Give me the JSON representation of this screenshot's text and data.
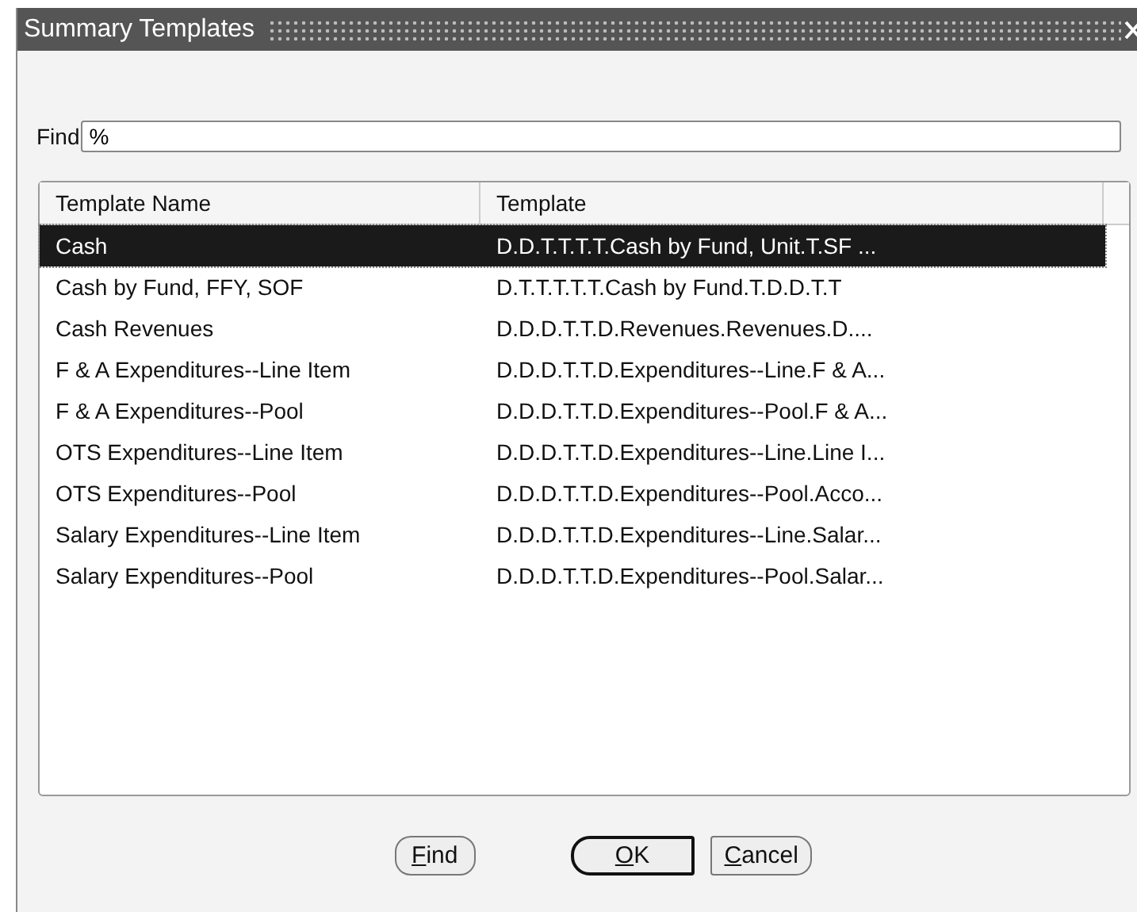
{
  "window": {
    "title": "Summary Templates"
  },
  "find": {
    "label": "Find",
    "value": "%"
  },
  "table": {
    "columns": [
      "Template Name",
      "Template"
    ],
    "rows": [
      {
        "name": "Cash",
        "template": "D.D.T.T.T.T.Cash by Fund, Unit.T.SF ...",
        "selected": true
      },
      {
        "name": "Cash by Fund, FFY, SOF",
        "template": "D.T.T.T.T.T.Cash by Fund.T.D.D.T.T",
        "selected": false
      },
      {
        "name": "Cash Revenues",
        "template": "D.D.D.T.T.D.Revenues.Revenues.D....",
        "selected": false
      },
      {
        "name": "F & A Expenditures--Line Item",
        "template": "D.D.D.T.T.D.Expenditures--Line.F & A...",
        "selected": false
      },
      {
        "name": "F & A Expenditures--Pool",
        "template": "D.D.D.T.T.D.Expenditures--Pool.F & A...",
        "selected": false
      },
      {
        "name": "OTS Expenditures--Line Item",
        "template": "D.D.D.T.T.D.Expenditures--Line.Line I...",
        "selected": false
      },
      {
        "name": "OTS Expenditures--Pool",
        "template": "D.D.D.T.T.D.Expenditures--Pool.Acco...",
        "selected": false
      },
      {
        "name": "Salary Expenditures--Line Item",
        "template": "D.D.D.T.T.D.Expenditures--Line.Salar...",
        "selected": false
      },
      {
        "name": "Salary Expenditures--Pool",
        "template": "D.D.D.T.T.D.Expenditures--Pool.Salar...",
        "selected": false
      }
    ]
  },
  "buttons": [
    {
      "mnemonic": "F",
      "rest": "ind",
      "kind": "rounded"
    },
    {
      "mnemonic": "O",
      "rest": "K",
      "kind": "default"
    },
    {
      "mnemonic": "C",
      "rest": "ancel",
      "kind": "plain"
    }
  ]
}
